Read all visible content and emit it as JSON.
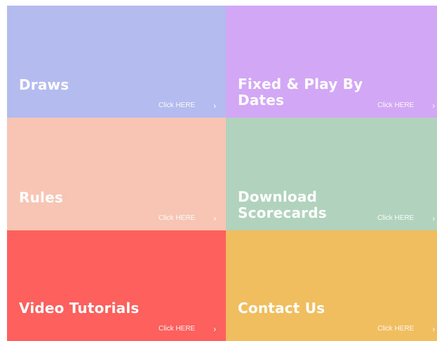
{
  "tiles": [
    {
      "title": "Draws",
      "link_label": "Click HERE",
      "chevron": "›",
      "color": "#b3bbef"
    },
    {
      "title": "Fixed & Play By\nDates",
      "link_label": "Click HERE",
      "chevron": "›",
      "color": "#d2a8f6"
    },
    {
      "title": "Rules",
      "link_label": "Click HERE",
      "chevron": "›",
      "color": "#f8c5b4"
    },
    {
      "title": "Download\nScorecards",
      "link_label": "Click HERE",
      "chevron": "›",
      "color": "#b1d2bc"
    },
    {
      "title": "Video Tutorials",
      "link_label": "Click HERE",
      "chevron": "›",
      "color": "#fe605e"
    },
    {
      "title": "Contact Us",
      "link_label": "Click HERE",
      "chevron": "›",
      "color": "#f0bd5f"
    }
  ]
}
